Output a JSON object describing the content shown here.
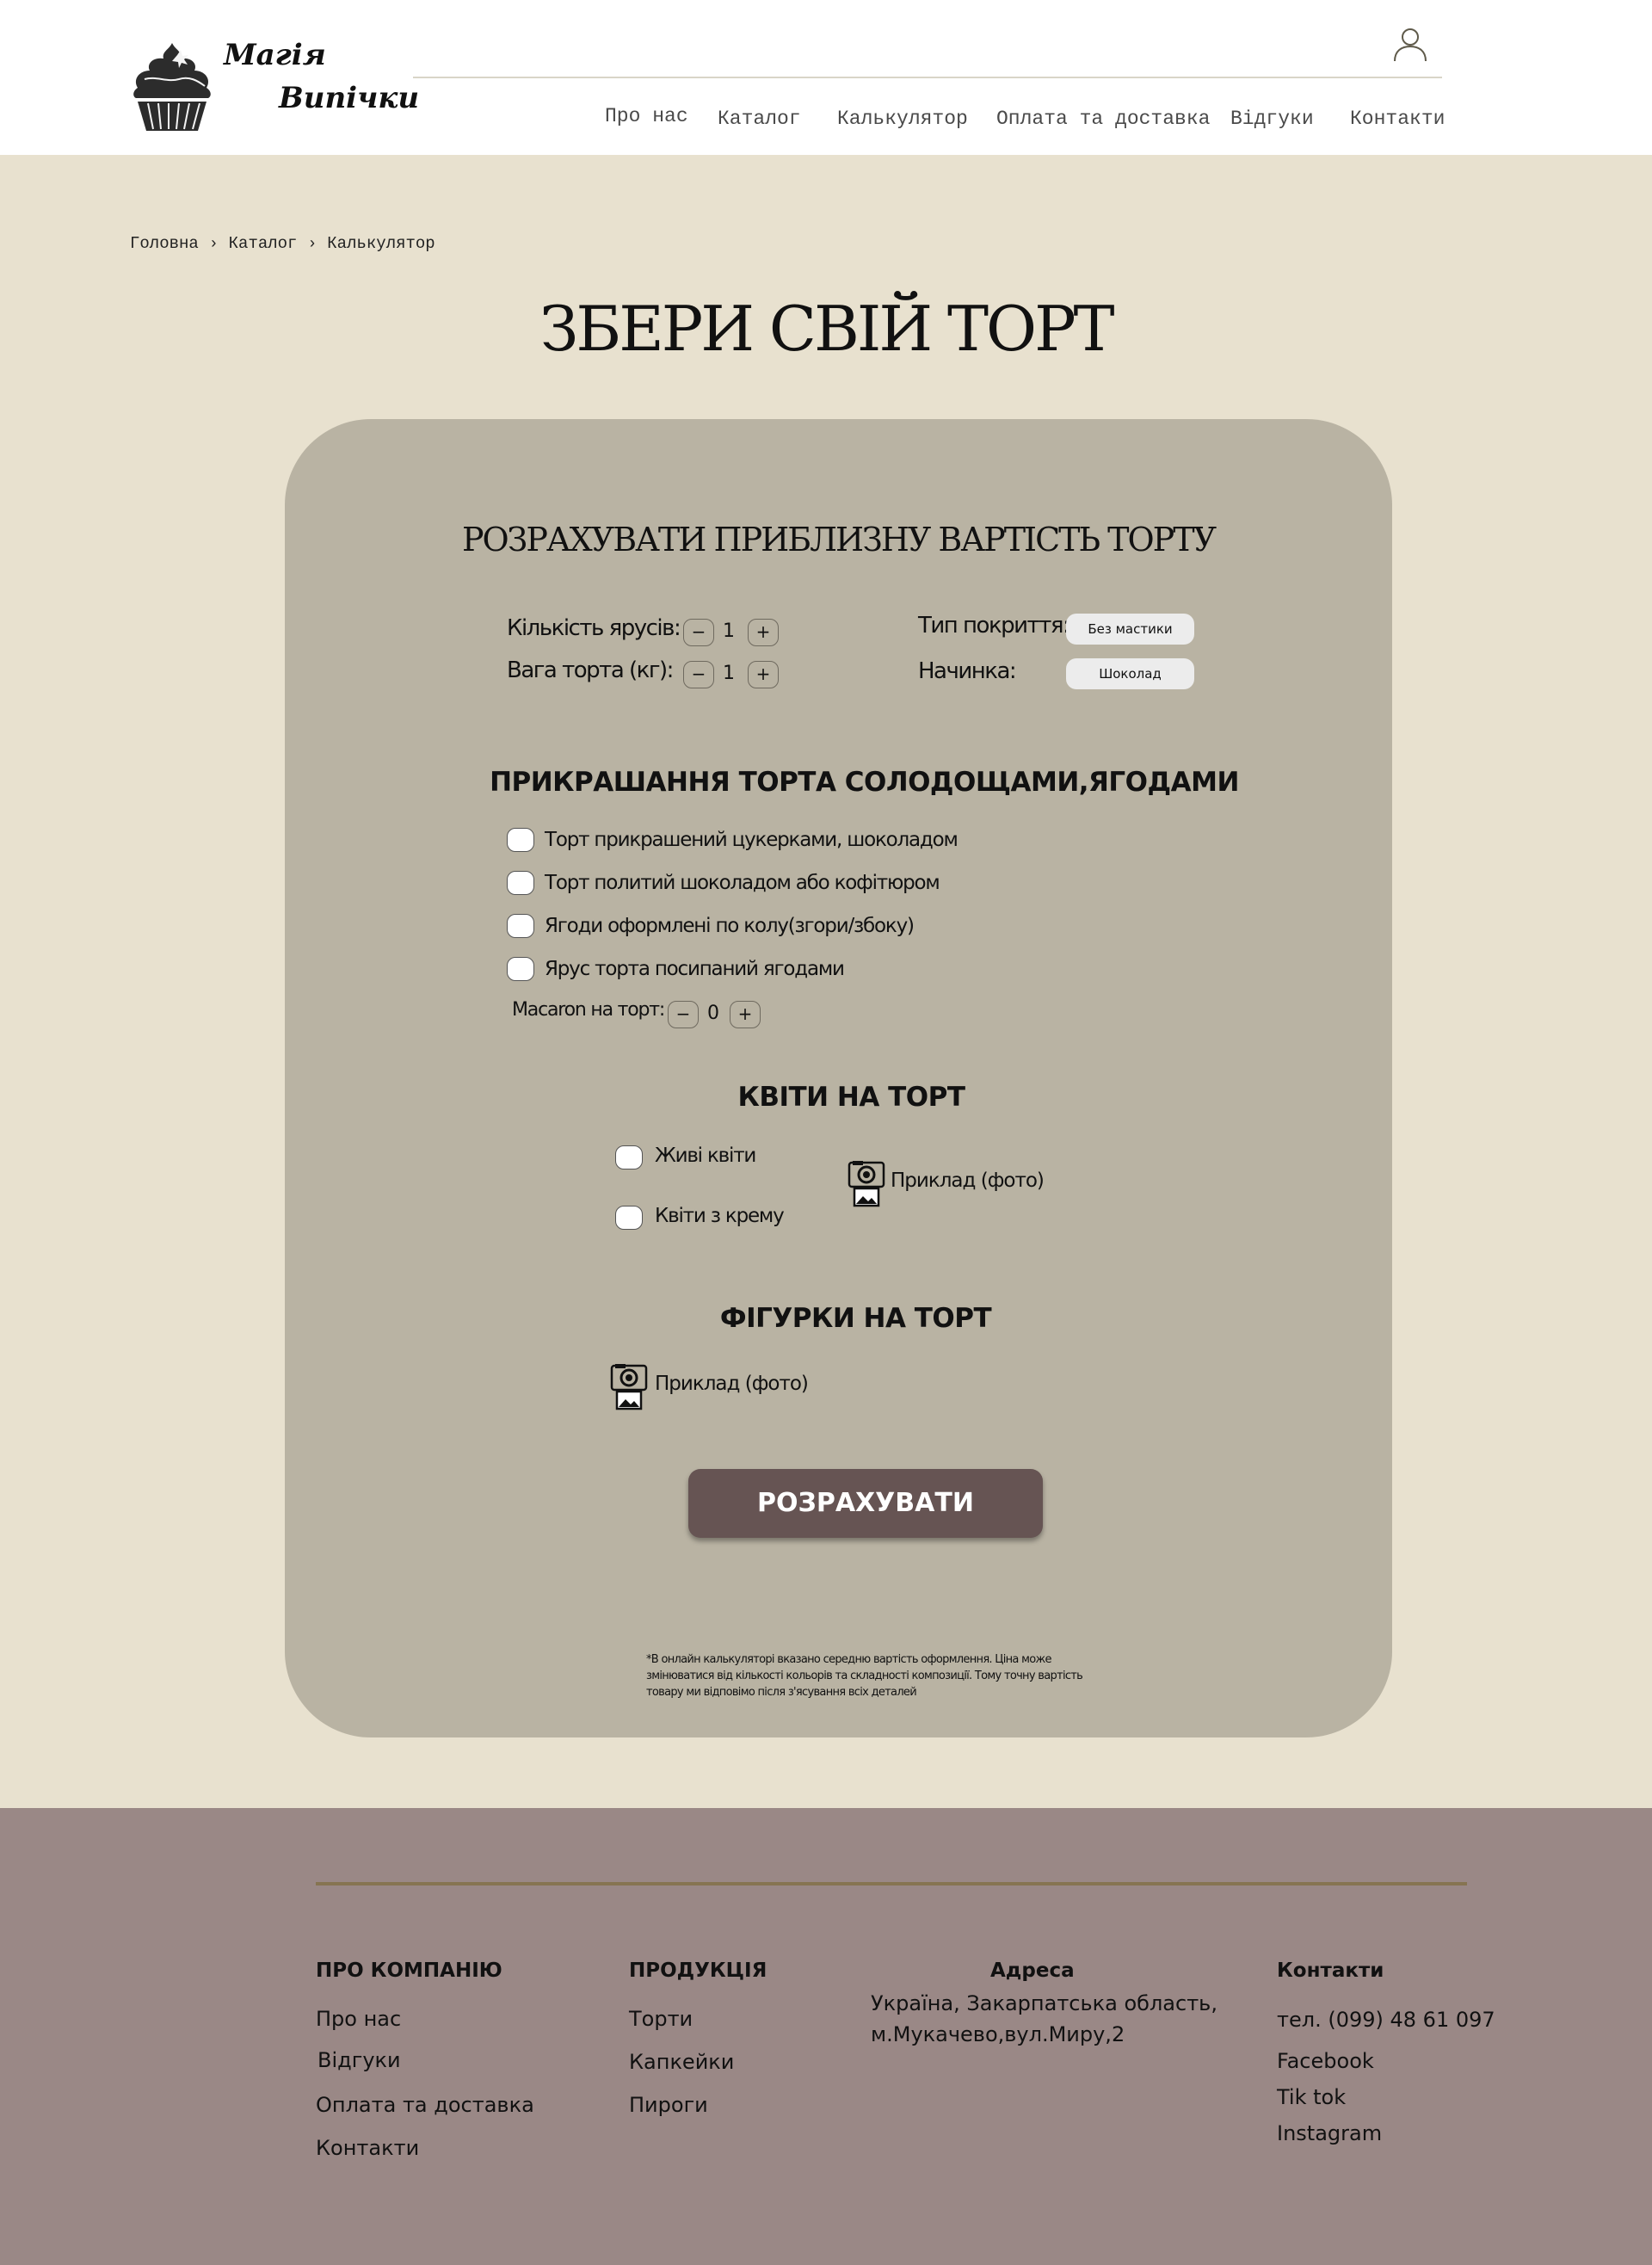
{
  "brand": {
    "line1": "Магія",
    "line2": "Випічки"
  },
  "nav": {
    "items": [
      "Про нас",
      "Каталог",
      "Калькулятор",
      "Оплата та доставка",
      "Відгуки",
      "Контакти"
    ]
  },
  "breadcrumb": {
    "items": [
      "Головна",
      "Каталог",
      "Калькулятор"
    ],
    "separator": "›"
  },
  "page": {
    "title": "ЗБЕРИ СВІЙ ТОРТ"
  },
  "calculator": {
    "title": "РОЗРАХУВАТИ ПРИБЛИЗНУ ВАРТІСТЬ ТОРТУ",
    "tiers": {
      "label": "Кількість ярусів:",
      "value": "1",
      "minus": "−",
      "plus": "+"
    },
    "weight": {
      "label": "Вага торта (кг):",
      "value": "1",
      "minus": "−",
      "plus": "+"
    },
    "coating": {
      "label": "Тип покриття:",
      "value": "Без  мастики"
    },
    "filling": {
      "label": "Начинка:",
      "value": "Шоколад"
    },
    "decor": {
      "title": "ПРИКРАШАННЯ ТОРТА СОЛОДОЩАМИ,ЯГОДАМИ",
      "options": [
        "Торт прикрашений цукерками, шоколадом",
        "Торт политий шоколадом або кофітюром",
        "Ягоди оформлені по колу(згори/збоку)",
        "Ярус торта посипаний ягодами"
      ],
      "macaron": {
        "label": "Macaron на торт:",
        "value": "0",
        "minus": "−",
        "plus": "+"
      }
    },
    "flowers": {
      "title": "КВІТИ НА ТОРТ",
      "options": [
        "Живі квіти",
        "Квіти з крему"
      ],
      "example": "Приклад (фото)"
    },
    "figures": {
      "title": "ФІГУРКИ НА ТОРТ",
      "example": "Приклад (фото)"
    },
    "submit": "РОЗРАХУВАТИ",
    "note": "*В онлайн калькуляторі вказано середню вартість оформлення. Ціна може змінюватися від кількості кольорів та складності композиції. Тому точну вартість товару ми відповімо після з'ясування всіх деталей"
  },
  "footer": {
    "company": {
      "title": "ПРО КОМПАНІЮ",
      "links": [
        "Про нас",
        "Відгуки",
        "Оплата та доставка",
        "Контакти"
      ]
    },
    "products": {
      "title": "ПРОДУКЦІЯ",
      "links": [
        "Торти",
        "Капкейки",
        "Пироги"
      ]
    },
    "address": {
      "title": "Адреса",
      "line1": "Україна, Закарпатська область,",
      "line2": "м.Мукачево,вул.Миру,2"
    },
    "contacts": {
      "title": "Контакти",
      "phone": "тел. (099) 48 61 097",
      "links": [
        "Facebook",
        "Tik tok",
        "Instagram"
      ]
    }
  },
  "colors": {
    "page_bg": "#e8e1cf",
    "card_bg": "#b9b3a3",
    "button": "#665453",
    "footer_bg": "#9a8886",
    "footer_line": "#867451"
  },
  "icons": {
    "logo": "cupcake-logo-icon",
    "user": "user-icon",
    "photo": "photo-camera-icon",
    "breadcrumb_sep": "chevron-right-icon"
  }
}
